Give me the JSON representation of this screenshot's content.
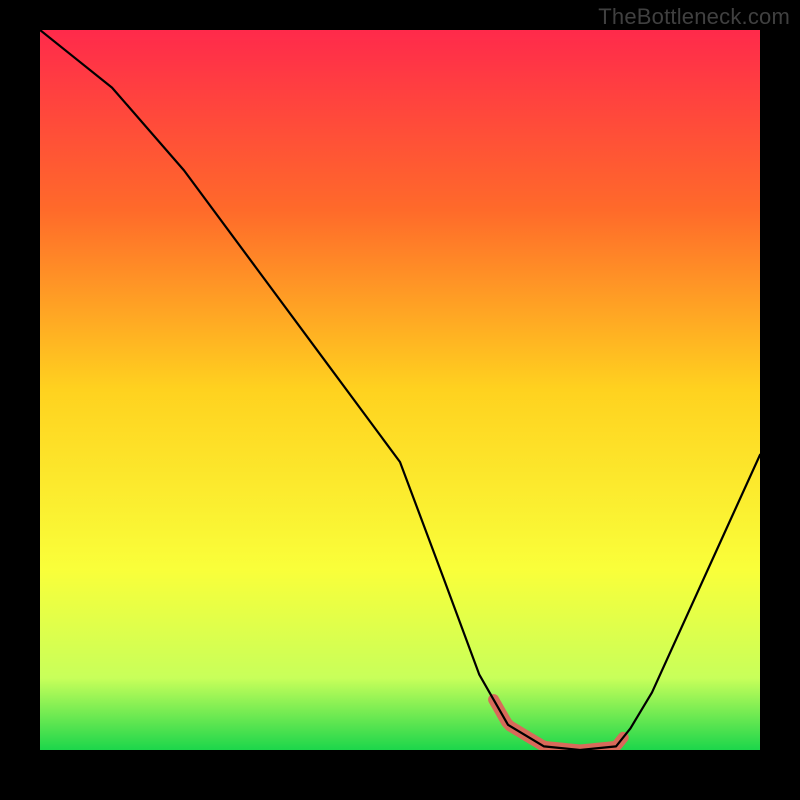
{
  "watermark": "TheBottleneck.com",
  "chart_data": {
    "type": "line",
    "title": "",
    "xlabel": "",
    "ylabel": "",
    "xlim": [
      0,
      100
    ],
    "ylim": [
      0,
      100
    ],
    "grid": false,
    "legend": false,
    "gradient_stops": [
      {
        "offset": 0,
        "color": "#ff2a4b"
      },
      {
        "offset": 25,
        "color": "#ff6a2a"
      },
      {
        "offset": 50,
        "color": "#ffd21f"
      },
      {
        "offset": 75,
        "color": "#f9ff3a"
      },
      {
        "offset": 90,
        "color": "#c8ff5a"
      },
      {
        "offset": 100,
        "color": "#1cd64b"
      }
    ],
    "series": [
      {
        "name": "bottleneck-curve",
        "color": "#000000",
        "x": [
          0,
          5,
          10,
          20,
          30,
          40,
          50,
          56,
          61,
          65,
          70,
          75,
          80,
          82,
          85,
          90,
          95,
          100
        ],
        "values": [
          100,
          96,
          92,
          80.5,
          67,
          53.5,
          40,
          24,
          10.5,
          3.5,
          0.5,
          0,
          0.5,
          3,
          8,
          19,
          30,
          41
        ]
      }
    ],
    "region": {
      "name": "optimal-range",
      "color": "#d86a5a",
      "x_start": 63,
      "x_end": 81
    }
  }
}
